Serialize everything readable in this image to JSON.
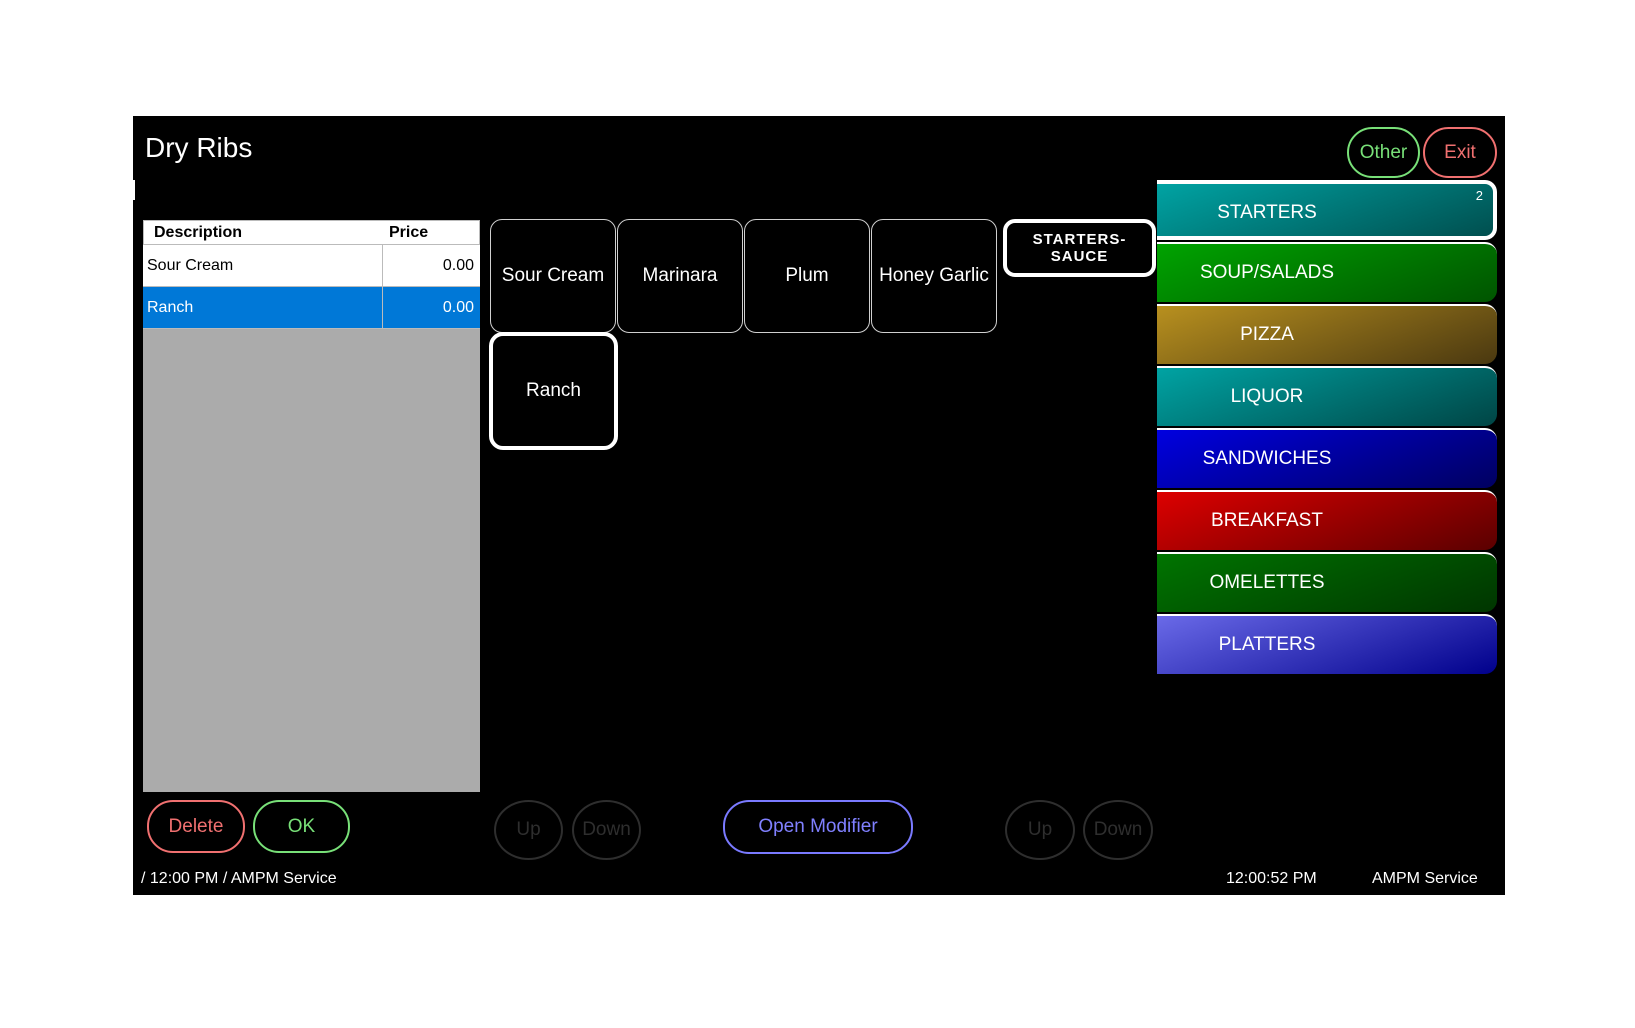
{
  "window": {
    "title": "Dry Ribs"
  },
  "header_buttons": {
    "other": "Other",
    "exit": "Exit"
  },
  "table": {
    "columns": [
      "Description",
      "Price"
    ],
    "rows": [
      {
        "description": "Sour Cream",
        "price": "0.00",
        "selected": false
      },
      {
        "description": "Ranch",
        "price": "0.00",
        "selected": true
      }
    ]
  },
  "modifiers": [
    {
      "label": "Sour Cream",
      "selected": false
    },
    {
      "label": "Marinara",
      "selected": false
    },
    {
      "label": "Plum",
      "selected": false
    },
    {
      "label": "Honey Garlic",
      "selected": false
    },
    {
      "label": "Ranch",
      "selected": true
    }
  ],
  "modifier_group": {
    "label_line1": "STARTERS-",
    "label_line2": "SAUCE"
  },
  "categories": [
    {
      "label": "STARTERS",
      "badge": "2",
      "active": true,
      "color_from": "#00a3a3",
      "color_to": "#004f4f"
    },
    {
      "label": "SOUP/SALADS",
      "active": false,
      "color_from": "#00a300",
      "color_to": "#005400"
    },
    {
      "label": "PIZZA",
      "active": false,
      "color_from": "#b8901f",
      "color_to": "#4a3810"
    },
    {
      "label": "LIQUOR",
      "active": false,
      "color_from": "#00a3a3",
      "color_to": "#004545"
    },
    {
      "label": "SANDWICHES",
      "active": false,
      "color_from": "#0000e0",
      "color_to": "#000060"
    },
    {
      "label": "BREAKFAST",
      "active": false,
      "color_from": "#dd0000",
      "color_to": "#5a0000"
    },
    {
      "label": "OMELETTES",
      "active": false,
      "color_from": "#007400",
      "color_to": "#003500"
    },
    {
      "label": "PLATTERS",
      "active": false,
      "color_from": "#6a6ae8",
      "color_to": "#00008b"
    }
  ],
  "bottom_buttons": {
    "delete": "Delete",
    "ok": "OK",
    "up_left": "Up",
    "down_left": "Down",
    "open_modifier": "Open Modifier",
    "up_right": "Up",
    "down_right": "Down"
  },
  "footer": {
    "left_status": "/ 12:00 PM / AMPM Service",
    "clock": "12:00:52 PM",
    "service": "AMPM Service"
  },
  "colors": {
    "selected_row": "#0078d7",
    "delete": "#f07070",
    "ok": "#78e078",
    "open_modifier": "#7a7aff"
  }
}
